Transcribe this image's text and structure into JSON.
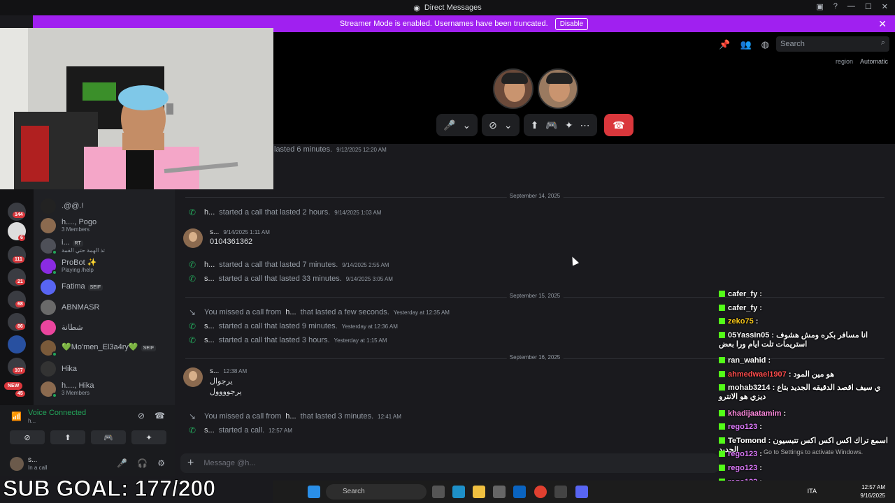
{
  "window": {
    "title": "Direct Messages"
  },
  "streamer_bar": {
    "message": "Streamer Mode is enabled. Usernames have been truncated.",
    "disable_label": "Disable"
  },
  "header": {
    "search_placeholder": "Search",
    "region_label": "region",
    "region_value": "Automatic"
  },
  "messages": {
    "top_partial": {
      "text": "lasted 6 minutes.",
      "time": "9/12/2025 12:20 AM"
    },
    "dividers": [
      "September 14, 2025",
      "September 15, 2025",
      "September 16, 2025"
    ],
    "items": [
      {
        "type": "call",
        "user": "h...",
        "text": "started a call that lasted 2 hours.",
        "time": "9/14/2025 1:03 AM"
      },
      {
        "type": "user",
        "user": "s...",
        "time": "9/14/2025 1:11 AM",
        "lines": [
          "0104361362"
        ]
      },
      {
        "type": "call",
        "user": "h...",
        "text": "started a call that lasted 7 minutes.",
        "time": "9/14/2025 2:55 AM"
      },
      {
        "type": "call",
        "user": "s...",
        "text": "started a call that lasted 33 minutes.",
        "time": "9/14/2025 3:05 AM"
      },
      {
        "type": "missed",
        "prefix": "You missed a call from",
        "user": "h...",
        "text": "that lasted a few seconds.",
        "time": "Yesterday at 12:35 AM"
      },
      {
        "type": "call",
        "user": "s...",
        "text": "started a call that lasted 9 minutes.",
        "time": "Yesterday at 12:36 AM"
      },
      {
        "type": "call",
        "user": "s...",
        "text": "started a call that lasted 3 hours.",
        "time": "Yesterday at 1:15 AM"
      },
      {
        "type": "user",
        "user": "s...",
        "time": "12:38 AM",
        "lines": [
          "يرجوال",
          "يرجوووول"
        ]
      },
      {
        "type": "missed",
        "prefix": "You missed a call from",
        "user": "h...",
        "text": "that lasted 3 minutes.",
        "time": "12:41 AM"
      },
      {
        "type": "call",
        "user": "s...",
        "text": "started a call.",
        "time": "12:57 AM"
      }
    ],
    "composer_placeholder": "Message @h..."
  },
  "servers": {
    "badges": [
      "144",
      "6",
      "111",
      "21",
      "68",
      "86",
      "107",
      "NEW",
      "45"
    ]
  },
  "dm_list": [
    {
      "name": ".@@.!",
      "sub": ""
    },
    {
      "name": "h...., Pogo",
      "sub": "3 Members"
    },
    {
      "name": "i...",
      "sub": "تذ الهمة حتي القمة",
      "tag": "RT"
    },
    {
      "name": "ProBot ✨",
      "sub": "Playing /help"
    },
    {
      "name": "Fatima",
      "sub": "",
      "tag": "SEIF"
    },
    {
      "name": "ABNMASR",
      "sub": ""
    },
    {
      "name": "شطانة",
      "sub": ""
    },
    {
      "name": "💚Mo'men_El3a4ry💚",
      "sub": "",
      "tag": "SEIF"
    },
    {
      "name": "Hika",
      "sub": ""
    },
    {
      "name": "h...., Hika",
      "sub": "3 Members"
    }
  ],
  "voice": {
    "status": "Voice Connected",
    "channel": "h..."
  },
  "user_panel": {
    "name": "s...",
    "status": "In a call"
  },
  "stream_overlay": {
    "sub_goal": "SUB GOAL: 177/200"
  },
  "chat": [
    {
      "user": "cafer_fy",
      "msg": ":",
      "color": "#ffffff"
    },
    {
      "user": "cafer_fy",
      "msg": ":",
      "color": "#ffffff"
    },
    {
      "user": "zeko75",
      "msg": ":",
      "color": "#f5c518"
    },
    {
      "user": "05Yassin05",
      "msg": ": انا مسافر بكره ومش هشوف استريمات تلت ايام ورا بعض",
      "color": "#ffffff"
    },
    {
      "user": "ran_wahid",
      "msg": ":",
      "color": "#ffffff"
    },
    {
      "user": "ahmedwael1907",
      "msg": ": هو مين المود",
      "color": "#ff4d4d"
    },
    {
      "user": "mohab3214",
      "msg": ": ي سيف اقصد الدقيقه الجديد بتاع ديزي هو الانترو",
      "color": "#ffffff"
    },
    {
      "user": "khadijaatamim",
      "msg": ":",
      "color": "#ff8adf"
    },
    {
      "user": "rego123",
      "msg": ":",
      "color": "#e07bff"
    },
    {
      "user": "TeTomond",
      "msg": ": اسمع تراك اكس اكس اكس تتبسيون الجديد",
      "color": "#ffffff"
    },
    {
      "user": "rego123",
      "msg": ":",
      "color": "#e07bff"
    },
    {
      "user": "rego123",
      "msg": ":",
      "color": "#e07bff"
    },
    {
      "user": "rego123",
      "msg": ":",
      "color": "#e07bff"
    },
    {
      "user": "rego123",
      "msg": ":",
      "color": "#e07bff"
    }
  ],
  "watermark": "Go to Settings to activate Windows.",
  "taskbar": {
    "search_placeholder": "Search",
    "lang": "ITA",
    "time": "12:57 AM",
    "date": "9/16/2025"
  }
}
